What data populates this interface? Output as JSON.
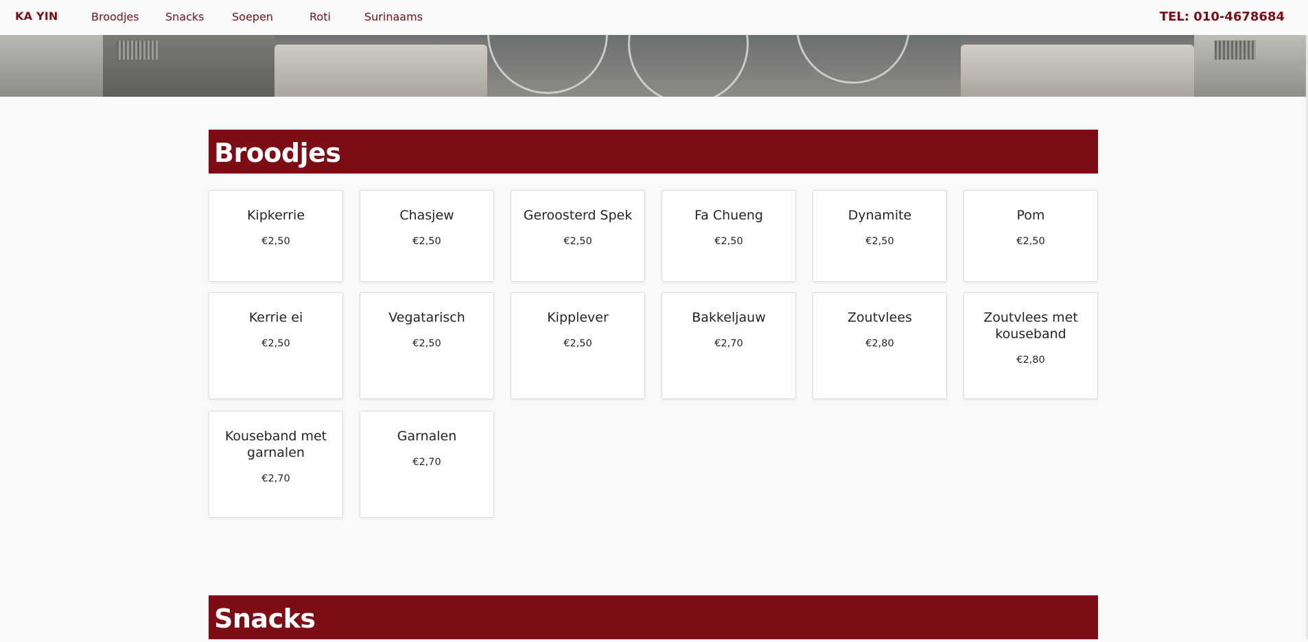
{
  "nav": {
    "brand": "KA YIN",
    "links": [
      "Broodjes",
      "Snacks",
      "Soepen",
      "Roti",
      "Surinaams"
    ],
    "phone": "TEL: 010-4678684"
  },
  "sections": [
    {
      "title": "Broodjes",
      "items": [
        {
          "name": "Kipkerrie",
          "price": "€2,50"
        },
        {
          "name": "Chasjew",
          "price": "€2,50"
        },
        {
          "name": "Geroosterd Spek",
          "price": "€2,50"
        },
        {
          "name": "Fa Chueng",
          "price": "€2,50"
        },
        {
          "name": "Dynamite",
          "price": "€2,50"
        },
        {
          "name": "Pom",
          "price": "€2,50"
        },
        {
          "name": "Kerrie ei",
          "price": "€2,50"
        },
        {
          "name": "Vegatarisch",
          "price": "€2,50"
        },
        {
          "name": "Kipplever",
          "price": "€2,50"
        },
        {
          "name": "Bakkeljauw",
          "price": "€2,70"
        },
        {
          "name": "Zoutvlees",
          "price": "€2,80"
        },
        {
          "name": "Zoutvlees met kouseband",
          "price": "€2,80"
        },
        {
          "name": "Kouseband met garnalen",
          "price": "€2,70"
        },
        {
          "name": "Garnalen",
          "price": "€2,70"
        }
      ]
    },
    {
      "title": "Snacks",
      "items": []
    }
  ],
  "colors": {
    "accent": "#7d0c15",
    "background": "#f8f9fa",
    "card": "#ffffff"
  }
}
